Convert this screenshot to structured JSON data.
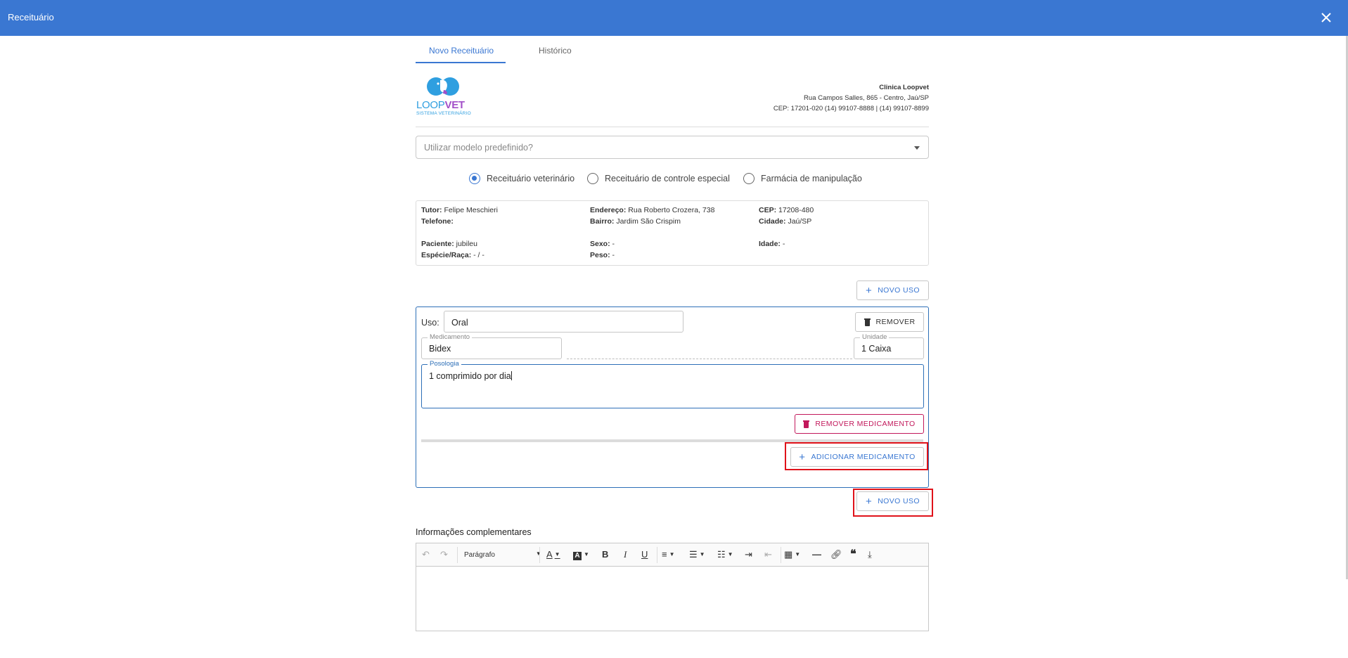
{
  "window": {
    "title": "Receituário"
  },
  "tabs": [
    {
      "label": "Novo Receituário",
      "active": true
    },
    {
      "label": "Histórico",
      "active": false
    }
  ],
  "logo": {
    "text_loop": "LOOP",
    "text_vet": "VET",
    "subtitle": "SISTEMA VETERINÁRIO"
  },
  "clinic": {
    "name": "Clinica Loopvet",
    "address": "Rua Campos Salles, 865 - Centro, Jaú/SP",
    "contact": "CEP: 17201-020 (14) 99107-8888 | (14) 99107-8899"
  },
  "template_select": {
    "placeholder": "Utilizar modelo predefinido?"
  },
  "prescription_types": [
    {
      "label": "Receituário veterinário",
      "checked": true
    },
    {
      "label": "Receituário de controle especial",
      "checked": false
    },
    {
      "label": "Farmácia de manipulação",
      "checked": false
    }
  ],
  "info": {
    "tutor_label": "Tutor:",
    "tutor": "Felipe Meschieri",
    "endereco_label": "Endereço:",
    "endereco": "Rua Roberto Crozera, 738",
    "cep_label": "CEP:",
    "cep": "17208-480",
    "telefone_label": "Telefone:",
    "telefone": "",
    "bairro_label": "Bairro:",
    "bairro": "Jardim São Crispim",
    "cidade_label": "Cidade:",
    "cidade": "Jaú/SP",
    "paciente_label": "Paciente:",
    "paciente": "jubileu",
    "sexo_label": "Sexo:",
    "sexo": "-",
    "idade_label": "Idade:",
    "idade": "-",
    "especie_label": "Espécie/Raça:",
    "especie": "- / -",
    "peso_label": "Peso:",
    "peso": "-"
  },
  "buttons": {
    "novo_uso": "NOVO USO",
    "remover": "REMOVER",
    "remover_medicamento": "REMOVER MEDICAMENTO",
    "adicionar_medicamento": "ADICIONAR MEDICAMENTO"
  },
  "uso": {
    "label": "Uso:",
    "value": "Oral",
    "medicamento_label": "Medicamento",
    "medicamento": "Bidex",
    "unidade_label": "Unidade",
    "unidade": "1 Caixa",
    "posologia_label": "Posologia",
    "posologia": "1 comprimido por dia"
  },
  "editor": {
    "section_label": "Informações complementares",
    "paragraph_style": "Parágrafo"
  },
  "colors": {
    "primary": "#3a77d2",
    "danger": "#c2185b",
    "highlight": "#e0121a"
  }
}
